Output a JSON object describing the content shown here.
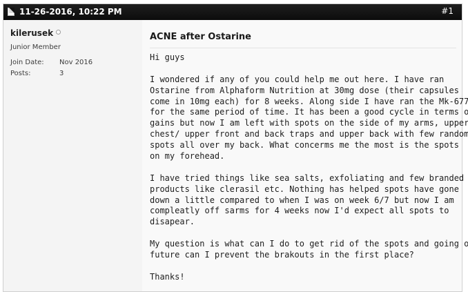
{
  "post": {
    "date": "11-26-2016, 10:22 PM",
    "number": "#1"
  },
  "user": {
    "name": "kilerusek",
    "title": "Junior Member",
    "join_date_label": "Join Date:",
    "join_date_value": "Nov 2016",
    "posts_label": "Posts:",
    "posts_value": "3"
  },
  "content": {
    "title": "ACNE after Ostarine",
    "greeting": "Hi guys",
    "paragraph1": [
      "I wondered if any of you could help me out here. I have ran",
      "Ostarine from Alphaform Nutrition at 30mg dose (their capsules",
      "come in 10mg each) for 8 weeks. Along side I have ran the Mk-677",
      "for the same period of time. It has been a good cycle in terms of",
      "gains but now I am left with spots on the side of my arms, upper",
      "chest/ upper front and back traps and upper back with few random",
      "spots all over my back. What concerms me the most is the spots",
      "on my forehead."
    ],
    "paragraph2": [
      "I have tried things like sea salts, exfoliating and few branded acne",
      "products like clerasil etc. Nothing has helped spots have gone",
      "down a little compared to when I was on week 6/7 but now I am",
      "compleatly off sarms for 4 weeks now I'd expect all spots to",
      "disapear."
    ],
    "paragraph3": [
      "My question is what can I do to get rid of the spots and going on in",
      "future can I prevent the brakouts in the first place?"
    ],
    "signoff": "Thanks!"
  }
}
